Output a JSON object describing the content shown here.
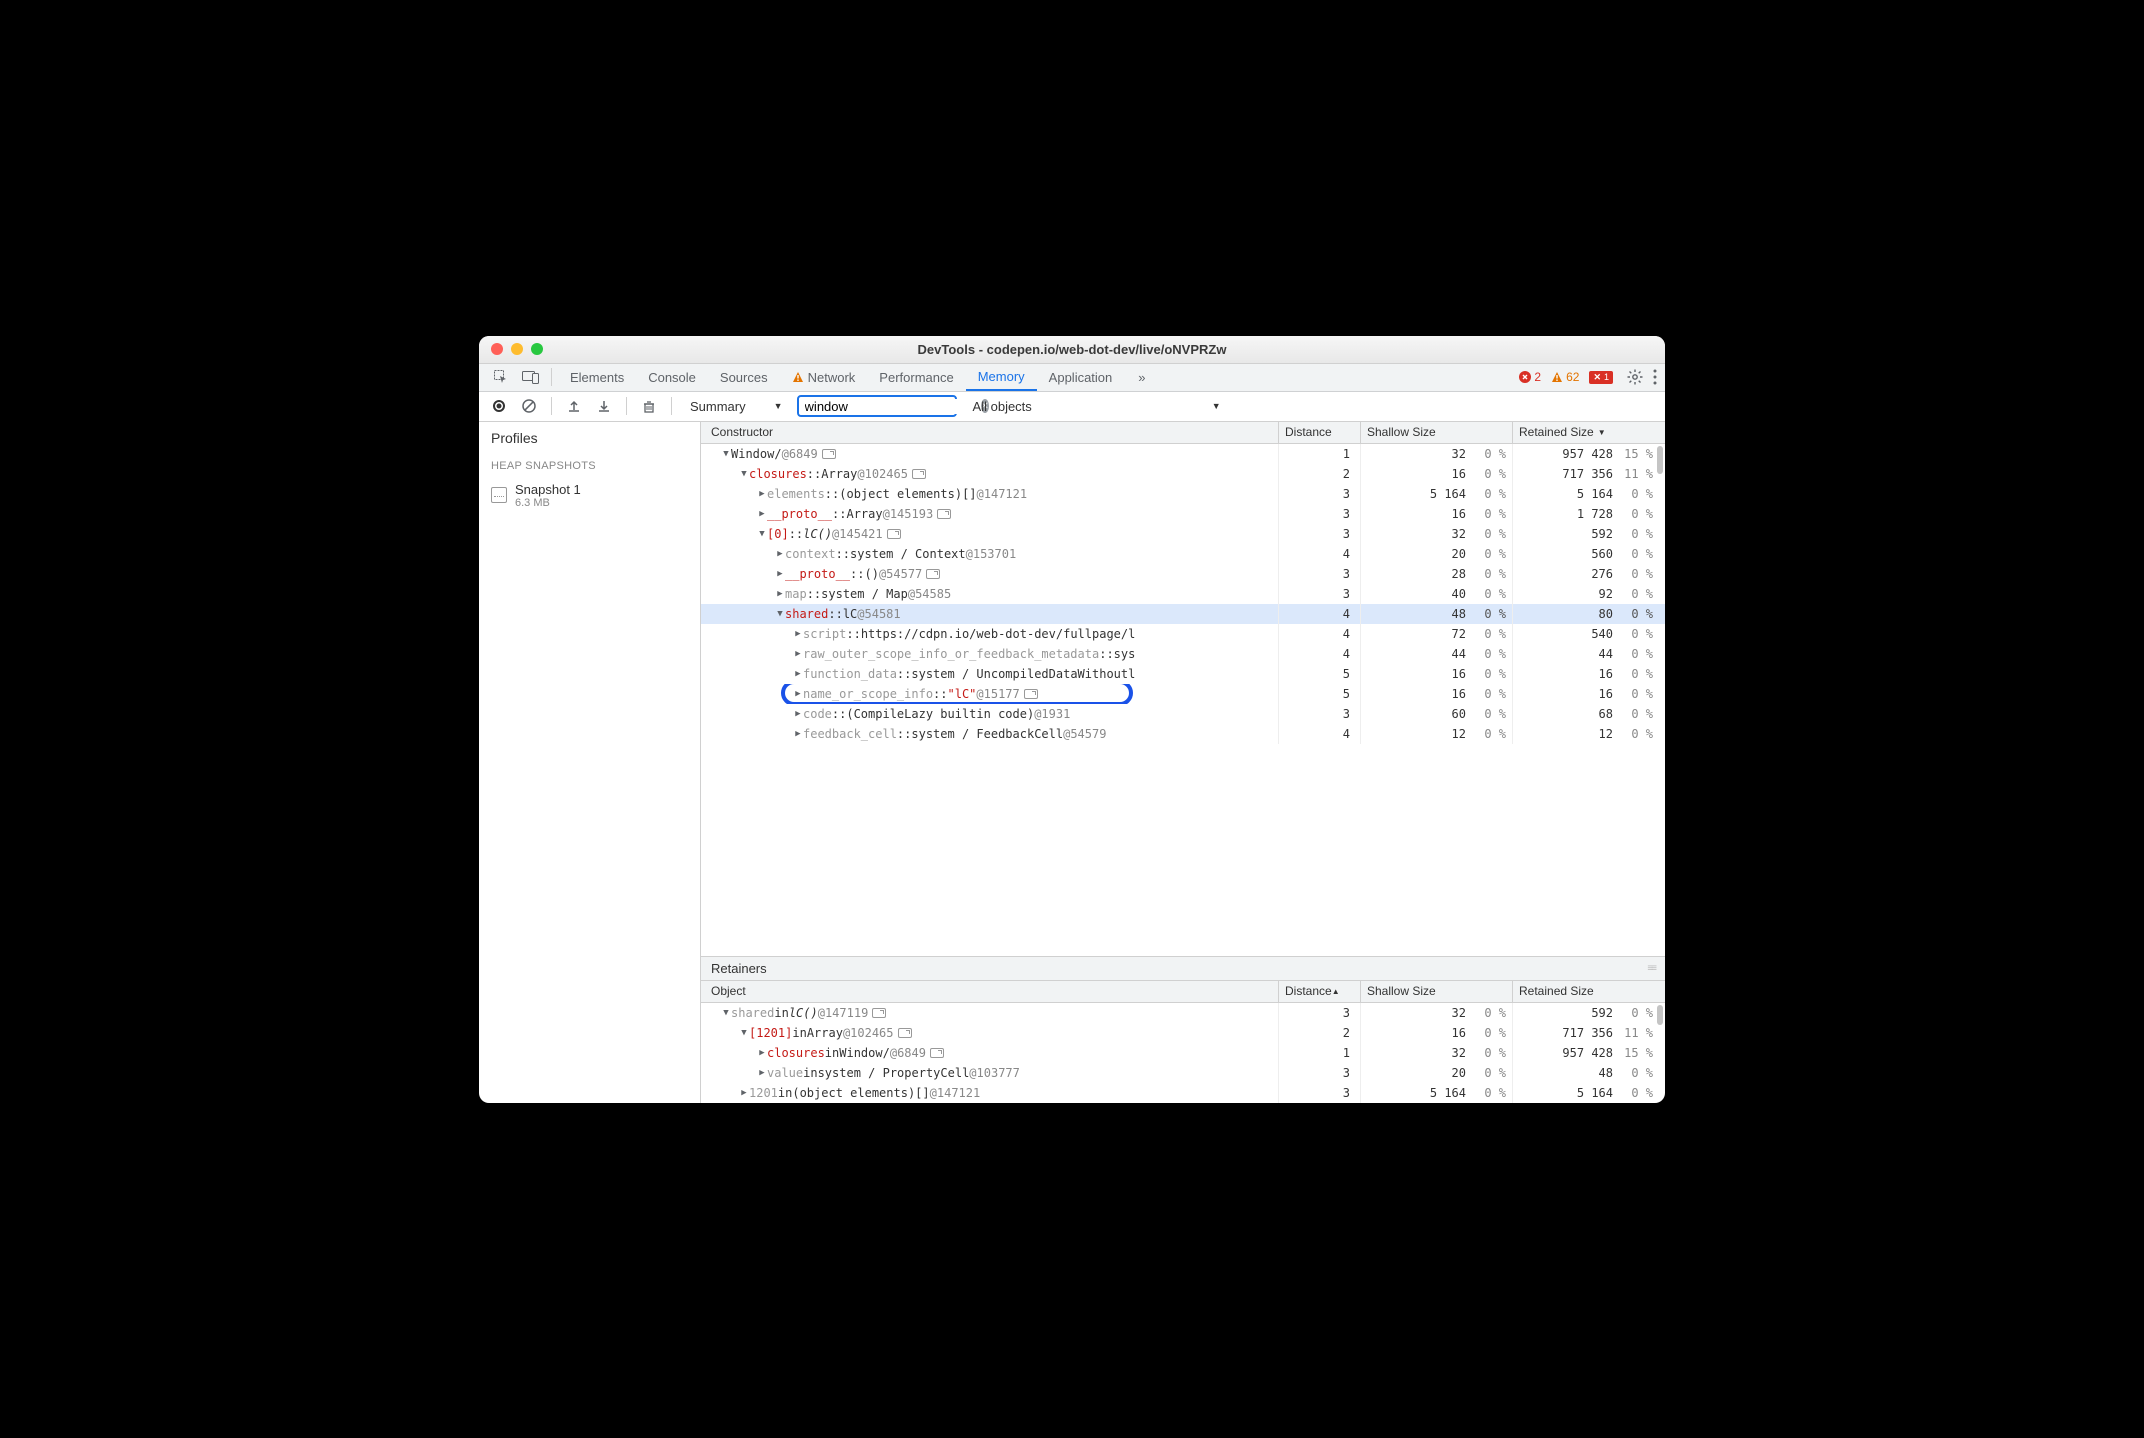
{
  "window_title": "DevTools - codepen.io/web-dot-dev/live/oNVPRZw",
  "tabs": [
    "Elements",
    "Console",
    "Sources",
    "Network",
    "Performance",
    "Memory",
    "Application"
  ],
  "active_tab": "Memory",
  "more_tabs_glyph": "»",
  "error_count": "2",
  "warn_count": "62",
  "x_count": "1",
  "toolbar": {
    "summary_label": "Summary",
    "filter_value": "window",
    "all_objects_label": "All objects"
  },
  "sidebar": {
    "profiles_label": "Profiles",
    "heap_section": "HEAP SNAPSHOTS",
    "snapshot_name": "Snapshot 1",
    "snapshot_size": "6.3 MB"
  },
  "headers": {
    "constructor": "Constructor",
    "distance": "Distance",
    "shallow": "Shallow Size",
    "retained": "Retained Size"
  },
  "rows": [
    {
      "indent": 0,
      "arrow": "down",
      "parts": [
        {
          "t": "type",
          "v": "Window"
        },
        {
          "t": "plain",
          "v": " / "
        },
        {
          "t": "id",
          "v": "  @6849"
        },
        {
          "t": "goto",
          "v": ""
        }
      ],
      "dist": "1",
      "s": "32",
      "sp": "0 %",
      "r": "957 428",
      "rp": "15 %"
    },
    {
      "indent": 1,
      "arrow": "down",
      "parts": [
        {
          "t": "name",
          "v": "closures"
        },
        {
          "t": "plain",
          "v": " :: "
        },
        {
          "t": "type",
          "v": "Array"
        },
        {
          "t": "id",
          "v": " @102465"
        },
        {
          "t": "goto",
          "v": ""
        }
      ],
      "dist": "2",
      "s": "16",
      "sp": "0 %",
      "r": "717 356",
      "rp": "11 %"
    },
    {
      "indent": 2,
      "arrow": "right",
      "parts": [
        {
          "t": "prop",
          "v": "elements"
        },
        {
          "t": "plain",
          "v": " :: "
        },
        {
          "t": "type",
          "v": "(object elements)[]"
        },
        {
          "t": "id",
          "v": " @147121"
        }
      ],
      "dist": "3",
      "s": "5 164",
      "sp": "0 %",
      "r": "5 164",
      "rp": "0 %"
    },
    {
      "indent": 2,
      "arrow": "right",
      "parts": [
        {
          "t": "name",
          "v": "__proto__"
        },
        {
          "t": "plain",
          "v": " :: "
        },
        {
          "t": "type",
          "v": "Array"
        },
        {
          "t": "id",
          "v": " @145193"
        },
        {
          "t": "goto",
          "v": ""
        }
      ],
      "dist": "3",
      "s": "16",
      "sp": "0 %",
      "r": "1 728",
      "rp": "0 %"
    },
    {
      "indent": 2,
      "arrow": "down",
      "parts": [
        {
          "t": "name",
          "v": "[0]"
        },
        {
          "t": "plain",
          "v": " :: "
        },
        {
          "t": "ital",
          "v": "lC()"
        },
        {
          "t": "id",
          "v": " @145421"
        },
        {
          "t": "goto",
          "v": ""
        }
      ],
      "dist": "3",
      "s": "32",
      "sp": "0 %",
      "r": "592",
      "rp": "0 %"
    },
    {
      "indent": 3,
      "arrow": "right",
      "parts": [
        {
          "t": "prop",
          "v": "context"
        },
        {
          "t": "plain",
          "v": " :: "
        },
        {
          "t": "type",
          "v": "system / Context"
        },
        {
          "t": "id",
          "v": " @153701"
        }
      ],
      "dist": "4",
      "s": "20",
      "sp": "0 %",
      "r": "560",
      "rp": "0 %"
    },
    {
      "indent": 3,
      "arrow": "right",
      "parts": [
        {
          "t": "name",
          "v": "__proto__"
        },
        {
          "t": "plain",
          "v": " :: "
        },
        {
          "t": "type",
          "v": "()"
        },
        {
          "t": "id",
          "v": " @54577"
        },
        {
          "t": "goto",
          "v": ""
        }
      ],
      "dist": "3",
      "s": "28",
      "sp": "0 %",
      "r": "276",
      "rp": "0 %"
    },
    {
      "indent": 3,
      "arrow": "right",
      "parts": [
        {
          "t": "prop",
          "v": "map"
        },
        {
          "t": "plain",
          "v": " :: "
        },
        {
          "t": "type",
          "v": "system / Map"
        },
        {
          "t": "id",
          "v": " @54585"
        }
      ],
      "dist": "3",
      "s": "40",
      "sp": "0 %",
      "r": "92",
      "rp": "0 %"
    },
    {
      "indent": 3,
      "arrow": "down",
      "sel": true,
      "parts": [
        {
          "t": "name",
          "v": "shared"
        },
        {
          "t": "plain",
          "v": " :: "
        },
        {
          "t": "type",
          "v": "lC"
        },
        {
          "t": "id",
          "v": " @54581"
        }
      ],
      "dist": "4",
      "s": "48",
      "sp": "0 %",
      "r": "80",
      "rp": "0 %"
    },
    {
      "indent": 4,
      "arrow": "right",
      "parts": [
        {
          "t": "prop",
          "v": "script"
        },
        {
          "t": "plain",
          "v": " :: "
        },
        {
          "t": "type",
          "v": "https://cdpn.io/web-dot-dev/fullpage/l"
        }
      ],
      "dist": "4",
      "s": "72",
      "sp": "0 %",
      "r": "540",
      "rp": "0 %"
    },
    {
      "indent": 4,
      "arrow": "right",
      "parts": [
        {
          "t": "prop",
          "v": "raw_outer_scope_info_or_feedback_metadata"
        },
        {
          "t": "plain",
          "v": " :: "
        },
        {
          "t": "type",
          "v": "sys"
        }
      ],
      "dist": "4",
      "s": "44",
      "sp": "0 %",
      "r": "44",
      "rp": "0 %"
    },
    {
      "indent": 4,
      "arrow": "right",
      "parts": [
        {
          "t": "prop",
          "v": "function_data"
        },
        {
          "t": "plain",
          "v": " :: "
        },
        {
          "t": "type",
          "v": "system / UncompiledDataWithoutl"
        }
      ],
      "dist": "5",
      "s": "16",
      "sp": "0 %",
      "r": "16",
      "rp": "0 %"
    },
    {
      "indent": 4,
      "arrow": "right",
      "hl": true,
      "parts": [
        {
          "t": "prop",
          "v": "name_or_scope_info"
        },
        {
          "t": "plain",
          "v": " :: "
        },
        {
          "t": "str",
          "v": "\"lC\""
        },
        {
          "t": "id",
          "v": " @15177"
        },
        {
          "t": "goto",
          "v": ""
        }
      ],
      "dist": "5",
      "s": "16",
      "sp": "0 %",
      "r": "16",
      "rp": "0 %"
    },
    {
      "indent": 4,
      "arrow": "right",
      "parts": [
        {
          "t": "prop",
          "v": "code"
        },
        {
          "t": "plain",
          "v": " :: "
        },
        {
          "t": "type",
          "v": "(CompileLazy builtin code)"
        },
        {
          "t": "id",
          "v": " @1931"
        }
      ],
      "dist": "3",
      "s": "60",
      "sp": "0 %",
      "r": "68",
      "rp": "0 %"
    },
    {
      "indent": 4,
      "arrow": "right",
      "parts": [
        {
          "t": "prop",
          "v": "feedback_cell"
        },
        {
          "t": "plain",
          "v": " :: "
        },
        {
          "t": "type",
          "v": "system / FeedbackCell"
        },
        {
          "t": "id",
          "v": " @54579"
        }
      ],
      "dist": "4",
      "s": "12",
      "sp": "0 %",
      "r": "12",
      "rp": "0 %"
    }
  ],
  "retainers_label": "Retainers",
  "ret_headers": {
    "object": "Object",
    "distance": "Distance",
    "shallow": "Shallow Size",
    "retained": "Retained Size"
  },
  "ret_rows": [
    {
      "indent": 0,
      "arrow": "down",
      "parts": [
        {
          "t": "prop",
          "v": "shared"
        },
        {
          "t": "in",
          "v": " in "
        },
        {
          "t": "ital",
          "v": "lC()"
        },
        {
          "t": "id",
          "v": " @147119"
        },
        {
          "t": "goto",
          "v": ""
        }
      ],
      "dist": "3",
      "s": "32",
      "sp": "0 %",
      "r": "592",
      "rp": "0 %"
    },
    {
      "indent": 1,
      "arrow": "down",
      "parts": [
        {
          "t": "name",
          "v": "[1201]"
        },
        {
          "t": "in",
          "v": " in "
        },
        {
          "t": "type",
          "v": "Array"
        },
        {
          "t": "id",
          "v": " @102465"
        },
        {
          "t": "goto",
          "v": ""
        }
      ],
      "dist": "2",
      "s": "16",
      "sp": "0 %",
      "r": "717 356",
      "rp": "11 %"
    },
    {
      "indent": 2,
      "arrow": "right",
      "parts": [
        {
          "t": "name",
          "v": "closures"
        },
        {
          "t": "in",
          "v": " in "
        },
        {
          "t": "type",
          "v": "Window"
        },
        {
          "t": "plain",
          "v": " / "
        },
        {
          "t": "id",
          "v": "  @6849"
        },
        {
          "t": "goto",
          "v": ""
        }
      ],
      "dist": "1",
      "s": "32",
      "sp": "0 %",
      "r": "957 428",
      "rp": "15 %"
    },
    {
      "indent": 2,
      "arrow": "right",
      "parts": [
        {
          "t": "prop",
          "v": "value"
        },
        {
          "t": "in",
          "v": " in "
        },
        {
          "t": "type",
          "v": "system / PropertyCell"
        },
        {
          "t": "id",
          "v": " @103777"
        }
      ],
      "dist": "3",
      "s": "20",
      "sp": "0 %",
      "r": "48",
      "rp": "0 %"
    },
    {
      "indent": 1,
      "arrow": "right",
      "parts": [
        {
          "t": "prop",
          "v": "1201"
        },
        {
          "t": "in",
          "v": " in "
        },
        {
          "t": "type",
          "v": "(object elements)[]"
        },
        {
          "t": "id",
          "v": " @147121"
        }
      ],
      "dist": "3",
      "s": "5 164",
      "sp": "0 %",
      "r": "5 164",
      "rp": "0 %"
    }
  ]
}
